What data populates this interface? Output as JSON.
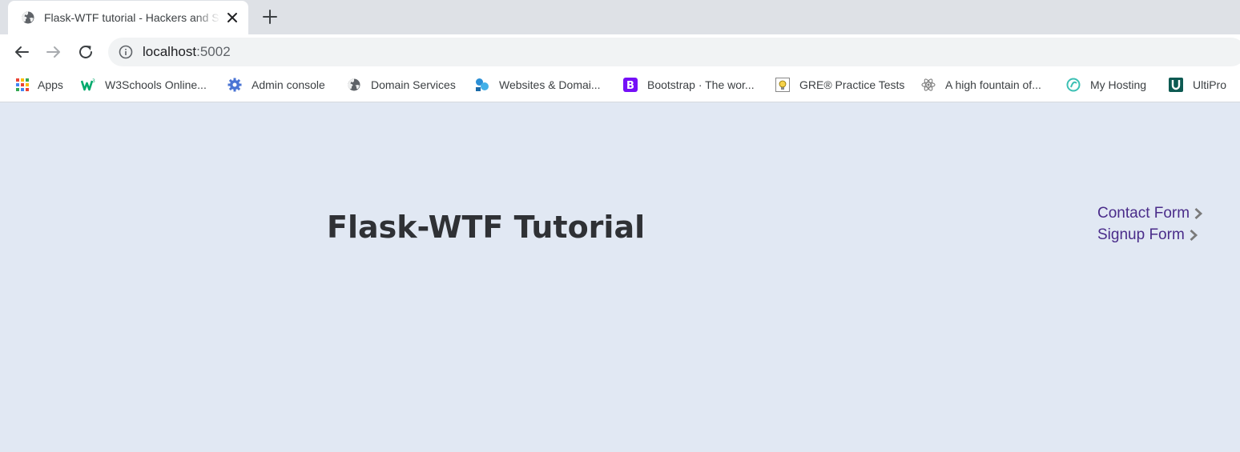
{
  "tab": {
    "title": "Flask-WTF tutorial - Hackers and Slackers",
    "favicon": "globe-icon"
  },
  "toolbar": {
    "url_host": "localhost",
    "url_port": ":5002"
  },
  "bookmarks": [
    {
      "label": "Apps",
      "icon": "apps-grid-icon"
    },
    {
      "label": "W3Schools Online...",
      "icon": "w3schools-icon"
    },
    {
      "label": "Admin console",
      "icon": "gear-icon"
    },
    {
      "label": "Domain Services",
      "icon": "globe-icon"
    },
    {
      "label": "Websites & Domai...",
      "icon": "websites-icon"
    },
    {
      "label": "Bootstrap · The wor...",
      "icon": "bootstrap-icon"
    },
    {
      "label": "GRE® Practice Tests",
      "icon": "lightbulb-icon"
    },
    {
      "label": "A high fountain of...",
      "icon": "atom-icon"
    },
    {
      "label": "My Hosting",
      "icon": "hosting-icon"
    },
    {
      "label": "UltiPro",
      "icon": "ultipro-icon"
    }
  ],
  "page": {
    "title": "Flask-WTF Tutorial",
    "links": [
      {
        "label": "Contact Form"
      },
      {
        "label": "Signup Form"
      }
    ]
  },
  "colors": {
    "page_bg": "#e1e8f3",
    "link": "#4a2c8a",
    "title": "#2f3135",
    "chevron": "#7a7a7a"
  }
}
